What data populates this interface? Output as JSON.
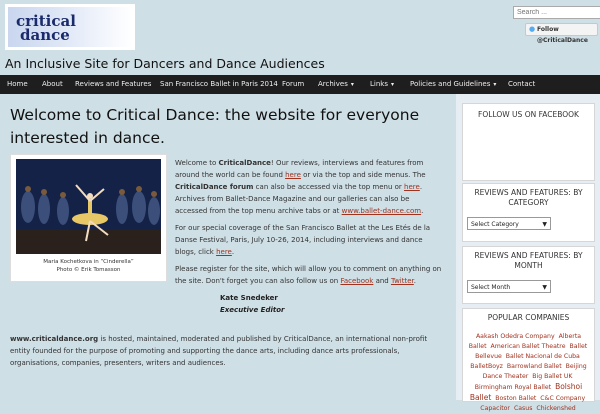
{
  "site": {
    "logo_line1": "critical",
    "logo_line2": "dance",
    "tagline": "An Inclusive Site for Dancers and Dance Audiences"
  },
  "search": {
    "placeholder": "Search ..."
  },
  "twitter": {
    "follow_label": "Follow @CriticalDance"
  },
  "nav": {
    "items": [
      {
        "label": "Home"
      },
      {
        "label": "About"
      },
      {
        "label": "Reviews and Features"
      },
      {
        "label": "San Francisco Ballet in Paris 2014"
      },
      {
        "label": "Forum"
      },
      {
        "label": "Archives",
        "caret": "▾"
      },
      {
        "label": "Links",
        "caret": "▾"
      },
      {
        "label": "Policies and Guidelines",
        "caret": "▾"
      },
      {
        "label": "Contact"
      }
    ]
  },
  "main": {
    "heading": "Welcome to Critical Dance: the website for everyone interested in dance.",
    "photo_caption_1": "Maria Kochetkova in “Cinderella”",
    "photo_caption_2": "Photo © Erik Tomasson",
    "p1": {
      "t1": "Welcome to ",
      "t2": "CriticalDance",
      "t3": "! Our reviews, interviews and features from around the world can be found ",
      "link1": "here",
      "t4": " or via the top and side menus. The ",
      "t5": "CriticalDance forum",
      "t6": " can also be accessed via the top menu or ",
      "link2": "here",
      "t7": ". Archives from Ballet-Dance Magazine and our galleries can also be accessed from the top menu archive tabs or at ",
      "link3": "www.ballet-dance.com",
      "t8": "."
    },
    "p2": {
      "t1": "For our special coverage of the San Francisco Ballet at the Les Etés de la Danse Festival, Paris, July 10-26, 2014, including interviews and dance blogs, click ",
      "link": "here",
      "t2": "."
    },
    "p3": {
      "t1": "Please register for the site, which will allow you to comment on anything on the site. Don't forget you can also follow us on ",
      "link1": "Facebook",
      "t2": " and ",
      "link2": "Twitter",
      "t3": "."
    },
    "signature_name": "Kate Snedeker",
    "signature_title": "Executive Editor",
    "footer": {
      "b": "www.criticaldance.org",
      "t": " is hosted, maintained, moderated and published by CriticalDance, an international non-profit entity founded for the purpose of promoting and supporting the dance arts, including dance arts professionals, organisations, companies, presenters, writers and audiences."
    }
  },
  "sidebar": {
    "facebook_title": "FOLLOW US ON FACEBOOK",
    "category_title": "REVIEWS AND FEATURES: BY CATEGORY",
    "category_select": "Select Category",
    "month_title": "REVIEWS AND FEATURES: BY MONTH",
    "month_select": "Select Month",
    "companies_title": "POPULAR COMPANIES",
    "companies": [
      "Aakash Odedra Company",
      "Alberta Ballet",
      "American Ballet Theatre",
      "Ballet Bellevue",
      "Ballet Nacional de Cuba",
      "BalletBoyz",
      "Barrowland Ballet",
      "Beijing Dance Theater",
      "Big Ballet UK",
      "Birmingham Royal Ballet",
      "Bolshoi Ballet",
      "Boston Ballet",
      "C&C Company",
      "Capacitor",
      "Casus",
      "Chickenshed"
    ]
  },
  "colors": {
    "background": "#cfdfe6",
    "nav": "#1e1e1e",
    "link": "#a0321e",
    "logo": "#1b2a6b"
  }
}
